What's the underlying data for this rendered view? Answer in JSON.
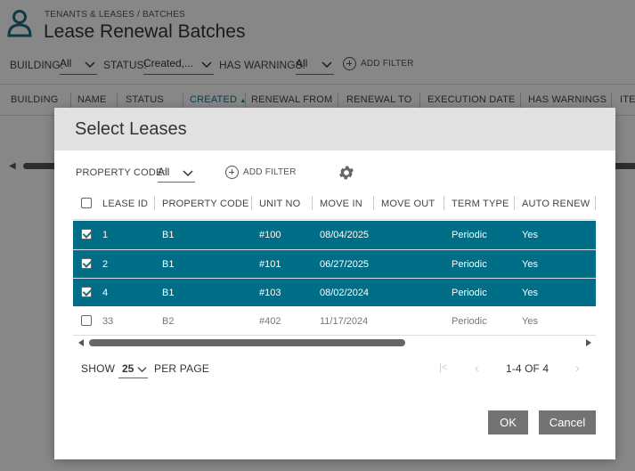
{
  "header": {
    "breadcrumb": "TENANTS & LEASES / BATCHES",
    "title": "Lease Renewal Batches"
  },
  "filters": {
    "building_label": "BUILDING:",
    "building_value": "All",
    "status_label": "STATUS:",
    "status_value": "Created,...",
    "warnings_label": "HAS WARNINGS:",
    "warnings_value": "All",
    "add_filter": "ADD FILTER"
  },
  "bg_table": {
    "columns": [
      "BUILDING",
      "NAME",
      "STATUS",
      "CREATED",
      "RENEWAL FROM",
      "RENEWAL TO",
      "EXECUTION DATE",
      "HAS WARNINGS",
      "ITE"
    ],
    "sorted_indicator": "▲"
  },
  "modal": {
    "title": "Select Leases",
    "filter_label": "PROPERTY CODE:",
    "filter_value": "All",
    "add_filter": "ADD FILTER",
    "columns": [
      "LEASE ID",
      "PROPERTY CODE",
      "UNIT NO",
      "MOVE IN",
      "MOVE OUT",
      "TERM TYPE",
      "AUTO RENEW"
    ],
    "rows": [
      {
        "lease_id": "1",
        "property_code": "B1",
        "unit_no": "#100",
        "move_in": "08/04/2025",
        "move_out": "",
        "term_type": "Periodic",
        "auto_renew": "Yes",
        "selected": true
      },
      {
        "lease_id": "2",
        "property_code": "B1",
        "unit_no": "#101",
        "move_in": "06/27/2025",
        "move_out": "",
        "term_type": "Periodic",
        "auto_renew": "Yes",
        "selected": true
      },
      {
        "lease_id": "4",
        "property_code": "B1",
        "unit_no": "#103",
        "move_in": "08/02/2024",
        "move_out": "",
        "term_type": "Periodic",
        "auto_renew": "Yes",
        "selected": true
      },
      {
        "lease_id": "33",
        "property_code": "B2",
        "unit_no": "#402",
        "move_in": "11/17/2024",
        "move_out": "",
        "term_type": "Periodic",
        "auto_renew": "Yes",
        "selected": false
      }
    ],
    "pager": {
      "show_label": "SHOW",
      "page_size": "25",
      "per_page_label": "PER PAGE",
      "range": "1-4 OF 4"
    },
    "ok_label": "OK",
    "cancel_label": "Cancel"
  },
  "colors": {
    "selected_row": "#006e86",
    "button": "#737373",
    "header_bar": "#e1e1e1"
  },
  "icons": [
    "user-icon",
    "chevron-down-icon",
    "plus-circle-icon",
    "gear-icon",
    "checkbox-icon",
    "first-page-icon",
    "prev-page-icon",
    "next-page-icon"
  ]
}
